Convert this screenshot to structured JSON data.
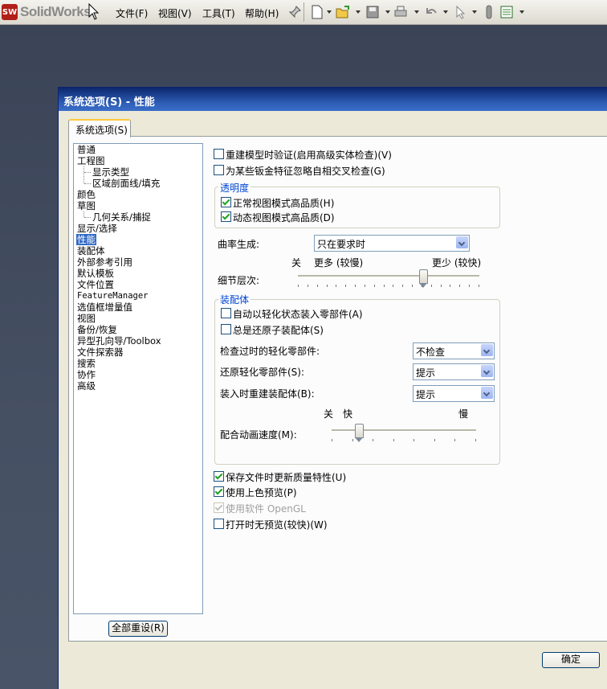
{
  "app": {
    "logo_text": "SolidWorks",
    "menus": [
      "文件(F)",
      "视图(V)",
      "工具(T)",
      "帮助(H)"
    ],
    "toolbar_icons": [
      "pin-icon",
      "new-document-icon",
      "open-folder-icon",
      "save-icon",
      "print-icon",
      "undo-icon",
      "select-arrow-icon",
      "rebuild-icon",
      "options-icon"
    ]
  },
  "dialog": {
    "title": "系统选项(S) - 性能",
    "tab_label": "系统选项(S)",
    "reset_button": "全部重设(R)",
    "ok_button": "确定",
    "tree": [
      {
        "label": "普通",
        "level": 0
      },
      {
        "label": "工程图",
        "level": 0
      },
      {
        "label": "显示类型",
        "level": 1
      },
      {
        "label": "区域剖面线/填充",
        "level": 1
      },
      {
        "label": "颜色",
        "level": 0
      },
      {
        "label": "草图",
        "level": 0
      },
      {
        "label": "几何关系/捕捉",
        "level": 1
      },
      {
        "label": "显示/选择",
        "level": 0
      },
      {
        "label": "性能",
        "level": 0,
        "selected": true
      },
      {
        "label": "装配体",
        "level": 0
      },
      {
        "label": "外部参考引用",
        "level": 0
      },
      {
        "label": "默认模板",
        "level": 0
      },
      {
        "label": "文件位置",
        "level": 0
      },
      {
        "label": "FeatureManager",
        "level": 0
      },
      {
        "label": "选值框增量值",
        "level": 0
      },
      {
        "label": "视图",
        "level": 0
      },
      {
        "label": "备份/恢复",
        "level": 0
      },
      {
        "label": "异型孔向导/Toolbox",
        "level": 0
      },
      {
        "label": "文件探索器",
        "level": 0
      },
      {
        "label": "搜索",
        "level": 0
      },
      {
        "label": "协作",
        "level": 0
      },
      {
        "label": "高级",
        "level": 0
      }
    ],
    "perf": {
      "verify_rebuild": {
        "label": "重建模型时验证(启用高级实体检查)(V)",
        "checked": false
      },
      "ignore_self_intersect": {
        "label": "为某些钣金特征忽略自相交叉检查(G)",
        "checked": false
      },
      "transparency": {
        "title": "透明度",
        "normal_view": {
          "label": "正常视图模式高品质(H)",
          "checked": true
        },
        "dynamic_view": {
          "label": "动态视图模式高品质(D)",
          "checked": true
        }
      },
      "curvature": {
        "label": "曲率生成:",
        "value": "只在要求时"
      },
      "level_of_detail": {
        "label": "细节层次:",
        "left": "关",
        "mid": "更多 (较慢)",
        "right": "更少 (较快)",
        "position": 0.69
      },
      "assemblies": {
        "title": "装配体",
        "auto_lightweight": {
          "label": "自动以轻化状态装入零部件(A)",
          "checked": false
        },
        "always_resolve": {
          "label": "总是还原子装配体(S)",
          "checked": false
        },
        "check_outdated": {
          "label": "检查过时的轻化零部件:",
          "value": "不检查"
        },
        "resolve_lightweight": {
          "label": "还原轻化零部件(S):",
          "value": "提示"
        },
        "rebuild_on_load": {
          "label": "装入时重建装配体(B):",
          "value": "提示"
        },
        "mate_animation": {
          "label": "配合动画速度(M):",
          "off": "关",
          "fast": "快",
          "slow": "慢",
          "position": 0.19
        }
      },
      "update_mass": {
        "label": "保存文件时更新质量特性(U)",
        "checked": true
      },
      "shaded_preview": {
        "label": "使用上色预览(P)",
        "checked": true
      },
      "software_opengl": {
        "label": "使用软件 OpenGL",
        "checked": true,
        "disabled": true
      },
      "no_preview": {
        "label": "打开时无预览(较快)(W)",
        "checked": false
      }
    }
  }
}
